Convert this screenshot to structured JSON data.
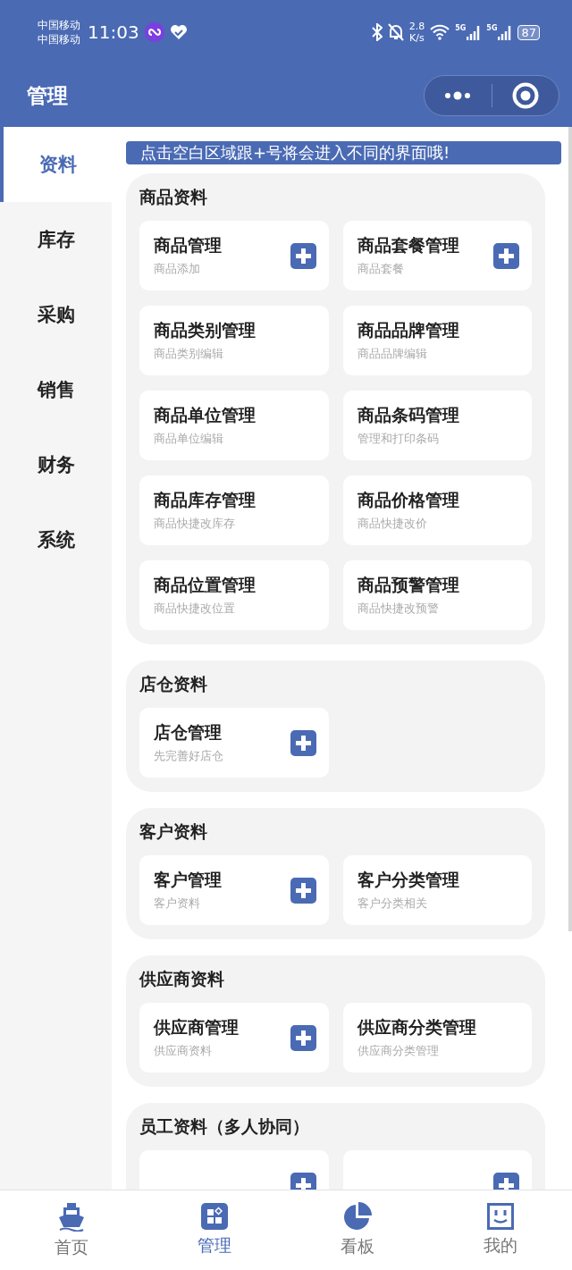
{
  "status_bar": {
    "carriers": [
      "中国移动",
      "中国移动"
    ],
    "time": "11:03",
    "speed_value": "2.8",
    "speed_unit": "K/s",
    "networks": [
      "5G",
      "5G"
    ],
    "battery": "87"
  },
  "header": {
    "title": "管理"
  },
  "sidebar": {
    "items": [
      {
        "label": "资料",
        "selected": true
      },
      {
        "label": "库存",
        "selected": false
      },
      {
        "label": "采购",
        "selected": false
      },
      {
        "label": "销售",
        "selected": false
      },
      {
        "label": "财务",
        "selected": false
      },
      {
        "label": "系统",
        "selected": false
      }
    ]
  },
  "banner": "点击空白区域跟+号将会进入不同的界面哦!",
  "sections": [
    {
      "title": "商品资料",
      "cards": [
        {
          "title": "商品管理",
          "subtitle": "商品添加",
          "plus": true
        },
        {
          "title": "商品套餐管理",
          "subtitle": "商品套餐",
          "plus": true
        },
        {
          "title": "商品类别管理",
          "subtitle": "商品类别编辑",
          "plus": false
        },
        {
          "title": "商品品牌管理",
          "subtitle": "商品品牌编辑",
          "plus": false
        },
        {
          "title": "商品单位管理",
          "subtitle": "商品单位编辑",
          "plus": false
        },
        {
          "title": "商品条码管理",
          "subtitle": "管理和打印条码",
          "plus": false
        },
        {
          "title": "商品库存管理",
          "subtitle": "商品快捷改库存",
          "plus": false
        },
        {
          "title": "商品价格管理",
          "subtitle": "商品快捷改价",
          "plus": false
        },
        {
          "title": "商品位置管理",
          "subtitle": "商品快捷改位置",
          "plus": false
        },
        {
          "title": "商品预警管理",
          "subtitle": "商品快捷改预警",
          "plus": false
        }
      ]
    },
    {
      "title": "店仓资料",
      "cards": [
        {
          "title": "店仓管理",
          "subtitle": "先完善好店仓",
          "plus": true
        }
      ]
    },
    {
      "title": "客户资料",
      "cards": [
        {
          "title": "客户管理",
          "subtitle": "客户资料",
          "plus": true
        },
        {
          "title": "客户分类管理",
          "subtitle": "客户分类相关",
          "plus": false
        }
      ]
    },
    {
      "title": "供应商资料",
      "cards": [
        {
          "title": "供应商管理",
          "subtitle": "供应商资料",
          "plus": true
        },
        {
          "title": "供应商分类管理",
          "subtitle": "供应商分类管理",
          "plus": false
        }
      ]
    },
    {
      "title": "员工资料（多人协同）",
      "cards": [
        {
          "plus": true
        },
        {
          "plus": true
        }
      ]
    }
  ],
  "tab_bar": [
    {
      "label": "首页",
      "kind": "ship",
      "selected": false
    },
    {
      "label": "管理",
      "kind": "grid",
      "selected": true
    },
    {
      "label": "看板",
      "kind": "pie",
      "selected": false
    },
    {
      "label": "我的",
      "kind": "face",
      "selected": false
    }
  ]
}
